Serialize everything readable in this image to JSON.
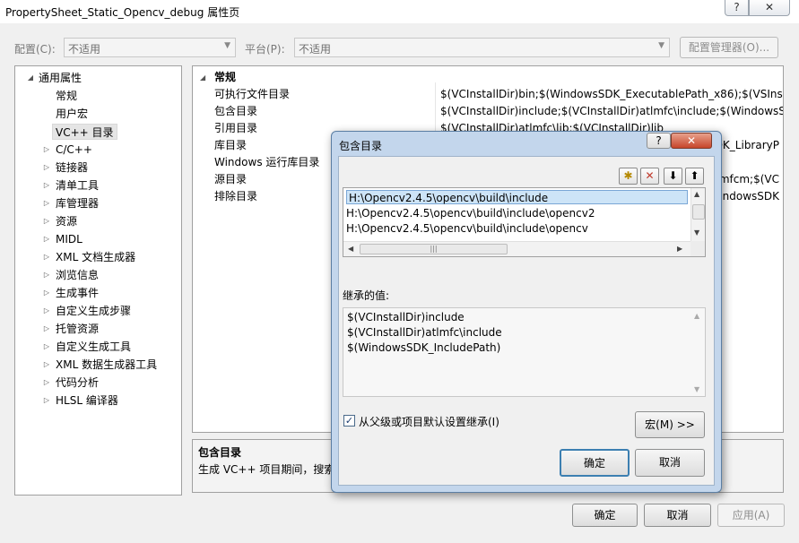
{
  "window": {
    "title": "PropertySheet_Static_Opencv_debug 属性页",
    "help_glyph": "?",
    "close_glyph": "✕"
  },
  "toolbar": {
    "config_label": "配置(C):",
    "config_value": "不适用",
    "platform_label": "平台(P):",
    "platform_value": "不适用",
    "config_manager_label": "配置管理器(O)..."
  },
  "tree": {
    "items": [
      {
        "label": "通用属性",
        "expander": "◢",
        "level": 0
      },
      {
        "label": "常规",
        "expander": "",
        "level": 1
      },
      {
        "label": "用户宏",
        "expander": "",
        "level": 1
      },
      {
        "label": "VC++ 目录",
        "expander": "",
        "level": 1,
        "selected": true
      },
      {
        "label": "C/C++",
        "expander": "▷",
        "level": 1
      },
      {
        "label": "链接器",
        "expander": "▷",
        "level": 1
      },
      {
        "label": "清单工具",
        "expander": "▷",
        "level": 1
      },
      {
        "label": "库管理器",
        "expander": "▷",
        "level": 1
      },
      {
        "label": "资源",
        "expander": "▷",
        "level": 1
      },
      {
        "label": "MIDL",
        "expander": "▷",
        "level": 1
      },
      {
        "label": "XML 文档生成器",
        "expander": "▷",
        "level": 1
      },
      {
        "label": "浏览信息",
        "expander": "▷",
        "level": 1
      },
      {
        "label": "生成事件",
        "expander": "▷",
        "level": 1
      },
      {
        "label": "自定义生成步骤",
        "expander": "▷",
        "level": 1
      },
      {
        "label": "托管资源",
        "expander": "▷",
        "level": 1
      },
      {
        "label": "自定义生成工具",
        "expander": "▷",
        "level": 1
      },
      {
        "label": "XML 数据生成器工具",
        "expander": "▷",
        "level": 1
      },
      {
        "label": "代码分析",
        "expander": "▷",
        "level": 1
      },
      {
        "label": "HLSL 编译器",
        "expander": "▷",
        "level": 1
      }
    ]
  },
  "grid": {
    "category": "常规",
    "category_expander": "◢",
    "rows": [
      {
        "name": "可执行文件目录",
        "value": "$(VCInstallDir)bin;$(WindowsSDK_ExecutablePath_x86);$(VSInstall"
      },
      {
        "name": "包含目录",
        "value": "$(VCInstallDir)include;$(VCInstallDir)atlmfc\\include;$(WindowsSDK"
      },
      {
        "name": "引用目录",
        "value": "$(VCInstallDir)atlmfc\\lib;$(VCInstallDir)lib"
      },
      {
        "name": "库目录",
        "value": "DK_LibraryP"
      },
      {
        "name": "Windows 运行库目录",
        "value": ""
      },
      {
        "name": "源目录",
        "value": "mfcm;$(VC"
      },
      {
        "name": "排除目录",
        "value": "WindowsSDK"
      }
    ]
  },
  "description": {
    "title": "包含目录",
    "text": "生成 VC++ 项目期间，搜索"
  },
  "bottom_buttons": {
    "ok": "确定",
    "cancel": "取消",
    "apply": "应用(A)"
  },
  "dialog": {
    "title": "包含目录",
    "help_glyph": "?",
    "close_glyph": "✕",
    "toolbar": {
      "new_glyph": "✱",
      "delete_glyph": "✕",
      "down_glyph": "⬇",
      "up_glyph": "⬆"
    },
    "paths": [
      "H:\\Opencv2.4.5\\opencv\\build\\include",
      "H:\\Opencv2.4.5\\opencv\\build\\include\\opencv2",
      "H:\\Opencv2.4.5\\opencv\\build\\include\\opencv"
    ],
    "inherited_label": "继承的值:",
    "inherited": [
      "$(VCInstallDir)include",
      "$(VCInstallDir)atlmfc\\include",
      "$(WindowsSDK_IncludePath)"
    ],
    "inherit_checkbox_label": "从父级或项目默认设置继承(I)",
    "inherit_checked": true,
    "macro_button": "宏(M) >>",
    "ok": "确定",
    "cancel": "取消",
    "hscroll_grip": "|||"
  },
  "colors": {
    "selection": "#cde4f7",
    "dialog_frame": "#c3d6ec",
    "close_red": "#c7452a"
  }
}
